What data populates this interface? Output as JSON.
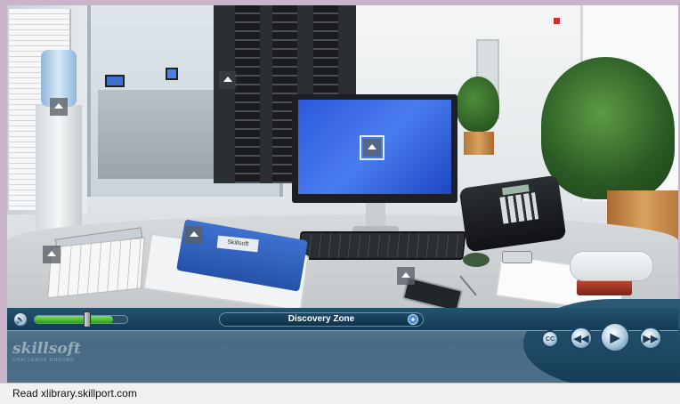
{
  "player": {
    "title": "Discovery Zone",
    "progress_fraction": 0.85
  },
  "logo": {
    "name": "skillsoft",
    "tagline": "CHALLENGE GROUND"
  },
  "scene": {
    "binder_tag": "Skillsoft"
  },
  "buttons": {
    "volume": "🔊",
    "info": "●",
    "cc": "CC",
    "rewind": "◀◀",
    "play": "▶",
    "forward": "▶▶"
  },
  "status_bar": {
    "text": "Read xlibrary.skillport.com"
  },
  "colors": {
    "control_bar": "#486b83",
    "progress": "#2c9e1a",
    "screen": "#2d58d8"
  }
}
